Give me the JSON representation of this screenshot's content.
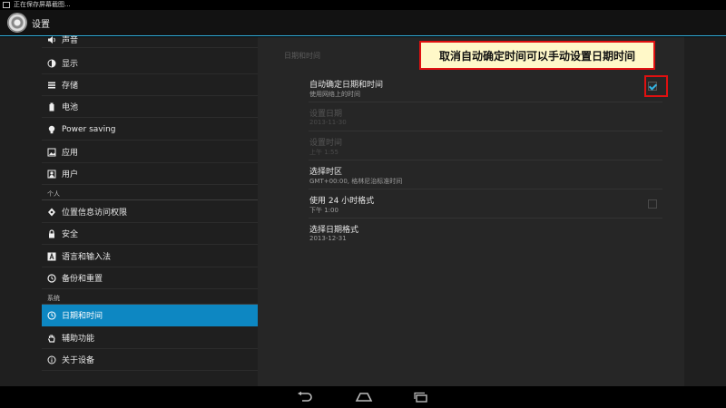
{
  "status_bar": {
    "text": "正在保存屏幕截图..."
  },
  "action_bar": {
    "title": "设置"
  },
  "sidebar": {
    "items": [
      {
        "label": "声音",
        "icon": "volume-icon"
      },
      {
        "label": "显示",
        "icon": "brightness-icon"
      },
      {
        "label": "存储",
        "icon": "storage-icon"
      },
      {
        "label": "电池",
        "icon": "battery-icon"
      },
      {
        "label": "Power saving",
        "icon": "lightbulb-icon"
      },
      {
        "label": "应用",
        "icon": "apps-icon"
      },
      {
        "label": "用户",
        "icon": "user-icon"
      },
      {
        "label": "位置信息访问权限",
        "icon": "location-icon"
      },
      {
        "label": "安全",
        "icon": "lock-icon"
      },
      {
        "label": "语言和输入法",
        "icon": "language-icon"
      },
      {
        "label": "备份和重置",
        "icon": "backup-icon"
      },
      {
        "label": "日期和时间",
        "icon": "clock-icon",
        "selected": true
      },
      {
        "label": "辅助功能",
        "icon": "hand-icon"
      },
      {
        "label": "关于设备",
        "icon": "info-icon"
      }
    ],
    "section_personal": "个人",
    "section_system": "系统"
  },
  "panel": {
    "title": "日期和时间",
    "prefs": [
      {
        "title": "自动确定日期和时间",
        "summary": "使用网络上的时间",
        "checked": true,
        "enabled": true
      },
      {
        "title": "设置日期",
        "summary": "2013-11-30",
        "enabled": false
      },
      {
        "title": "设置时间",
        "summary": "上午 1:55",
        "enabled": false
      },
      {
        "title": "选择时区",
        "summary": "GMT+00:00, 格林尼治标准时间",
        "enabled": true
      },
      {
        "title": "使用 24 小时格式",
        "summary": "下午 1:00",
        "checked": false,
        "enabled": true
      },
      {
        "title": "选择日期格式",
        "summary": "2013-12-31",
        "enabled": true
      }
    ]
  },
  "callout": {
    "text": "取消自动确定时间可以手动设置日期时间"
  },
  "colors": {
    "accent": "#33b5e5",
    "selected": "#0d87c2",
    "annotation": "#e01010"
  }
}
